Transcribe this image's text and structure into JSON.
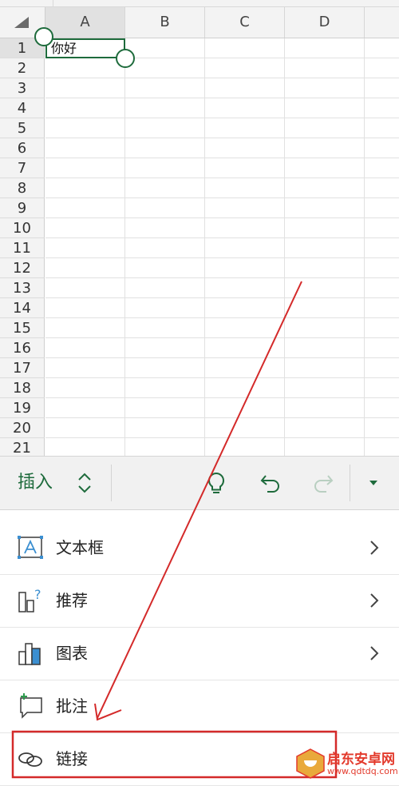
{
  "sheet": {
    "columns": [
      "A",
      "B",
      "C",
      "D"
    ],
    "rows": [
      "1",
      "2",
      "3",
      "4",
      "5",
      "6",
      "7",
      "8",
      "9",
      "10",
      "11",
      "12",
      "13",
      "14",
      "15",
      "16",
      "17",
      "18",
      "19",
      "20",
      "21"
    ],
    "selected_cell": "A1",
    "cell_A1_value": "你好"
  },
  "toolbar": {
    "tab_label": "插入",
    "tab_switch_icon": "chevron-up-down-icon",
    "idea_icon": "lightbulb-icon",
    "undo_icon": "undo-icon",
    "redo_icon": "redo-icon",
    "more_icon": "caret-down-icon"
  },
  "menu": {
    "items": [
      {
        "label": "文本框",
        "icon": "text-box-icon",
        "has_submenu": true
      },
      {
        "label": "推荐",
        "icon": "recommended-chart-icon",
        "has_submenu": true
      },
      {
        "label": "图表",
        "icon": "chart-icon",
        "has_submenu": true
      },
      {
        "label": "批注",
        "icon": "comment-icon",
        "has_submenu": false
      },
      {
        "label": "链接",
        "icon": "link-icon",
        "has_submenu": false
      }
    ]
  },
  "annotation": {
    "color": "#d42a2a",
    "highlighted_item": "链接"
  },
  "watermark": {
    "name": "启东安卓网",
    "url": "www.qdtdq.com"
  },
  "colors": {
    "accent": "#1e6b3c",
    "toolbar_bg": "#f1f1f1",
    "grid_header_bg": "#f3f3f3"
  }
}
